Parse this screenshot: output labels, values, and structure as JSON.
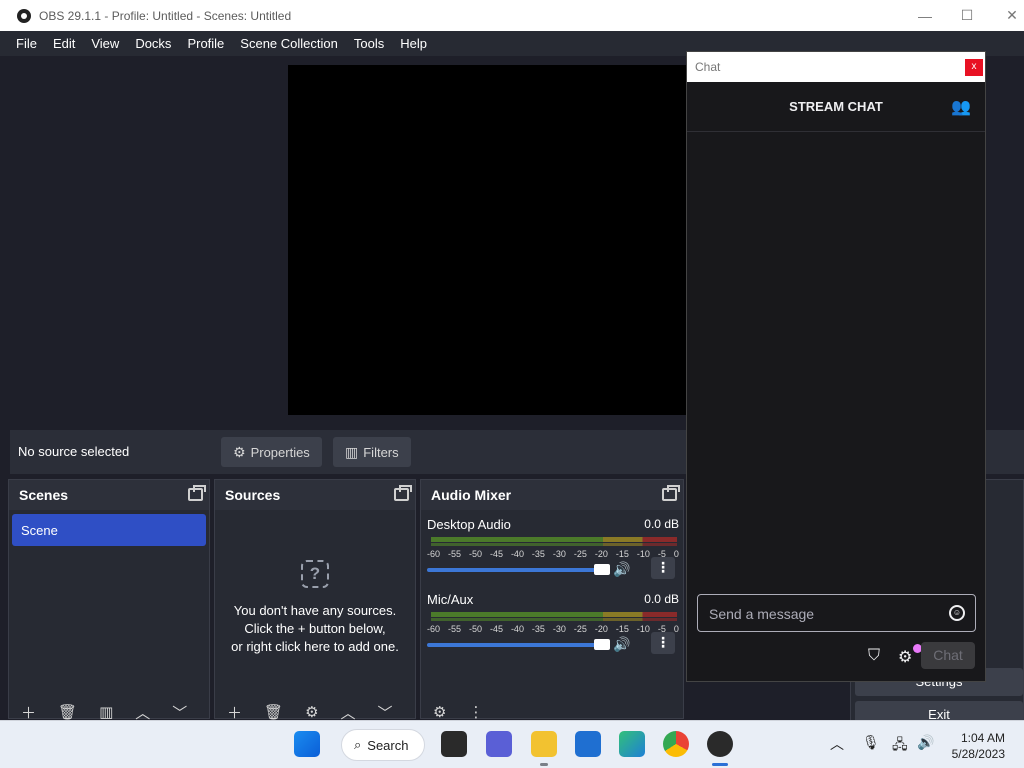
{
  "window": {
    "title": "OBS 29.1.1 - Profile: Untitled - Scenes: Untitled",
    "minimize": "—",
    "maximize": "☐",
    "close": "✕"
  },
  "menu": [
    "File",
    "Edit",
    "View",
    "Docks",
    "Profile",
    "Scene Collection",
    "Tools",
    "Help"
  ],
  "source_bar": {
    "status": "No source selected",
    "properties_label": "Properties",
    "filters_label": "Filters"
  },
  "scenes_dock": {
    "title": "Scenes",
    "items": [
      "Scene"
    ],
    "footer_icons": [
      "add-icon",
      "trash-icon",
      "filter-icon",
      "up-arrow-icon",
      "down-arrow-icon"
    ]
  },
  "sources_dock": {
    "title": "Sources",
    "empty_line1": "You don't have any sources.",
    "empty_line2": "Click the + button below,",
    "empty_line3": "or right click here to add one.",
    "footer_icons": [
      "add-icon",
      "trash-icon",
      "gear-icon",
      "up-arrow-icon",
      "down-arrow-icon"
    ]
  },
  "mixer_dock": {
    "title": "Audio Mixer",
    "channels": [
      {
        "name": "Desktop Audio",
        "db": "0.0 dB"
      },
      {
        "name": "Mic/Aux",
        "db": "0.0 dB"
      }
    ],
    "ticks": [
      "-60",
      "-55",
      "-50",
      "-45",
      "-40",
      "-35",
      "-30",
      "-25",
      "-20",
      "-15",
      "-10",
      "-5",
      "0"
    ]
  },
  "controls_dock": {
    "settings_label": "Settings",
    "exit_label": "Exit"
  },
  "chat": {
    "window_title": "Chat",
    "close_label": "x",
    "header": "STREAM CHAT",
    "input_placeholder": "Send a message",
    "send_label": "Chat"
  },
  "taskbar": {
    "search_label": "Search",
    "time": "1:04 AM",
    "date": "5/28/2023"
  },
  "colors": {
    "accent": "#2f4fc5",
    "panel": "#272a33",
    "chat_bg": "#18181b",
    "close_red": "#e81123",
    "notification_dot": "#e879f9"
  }
}
